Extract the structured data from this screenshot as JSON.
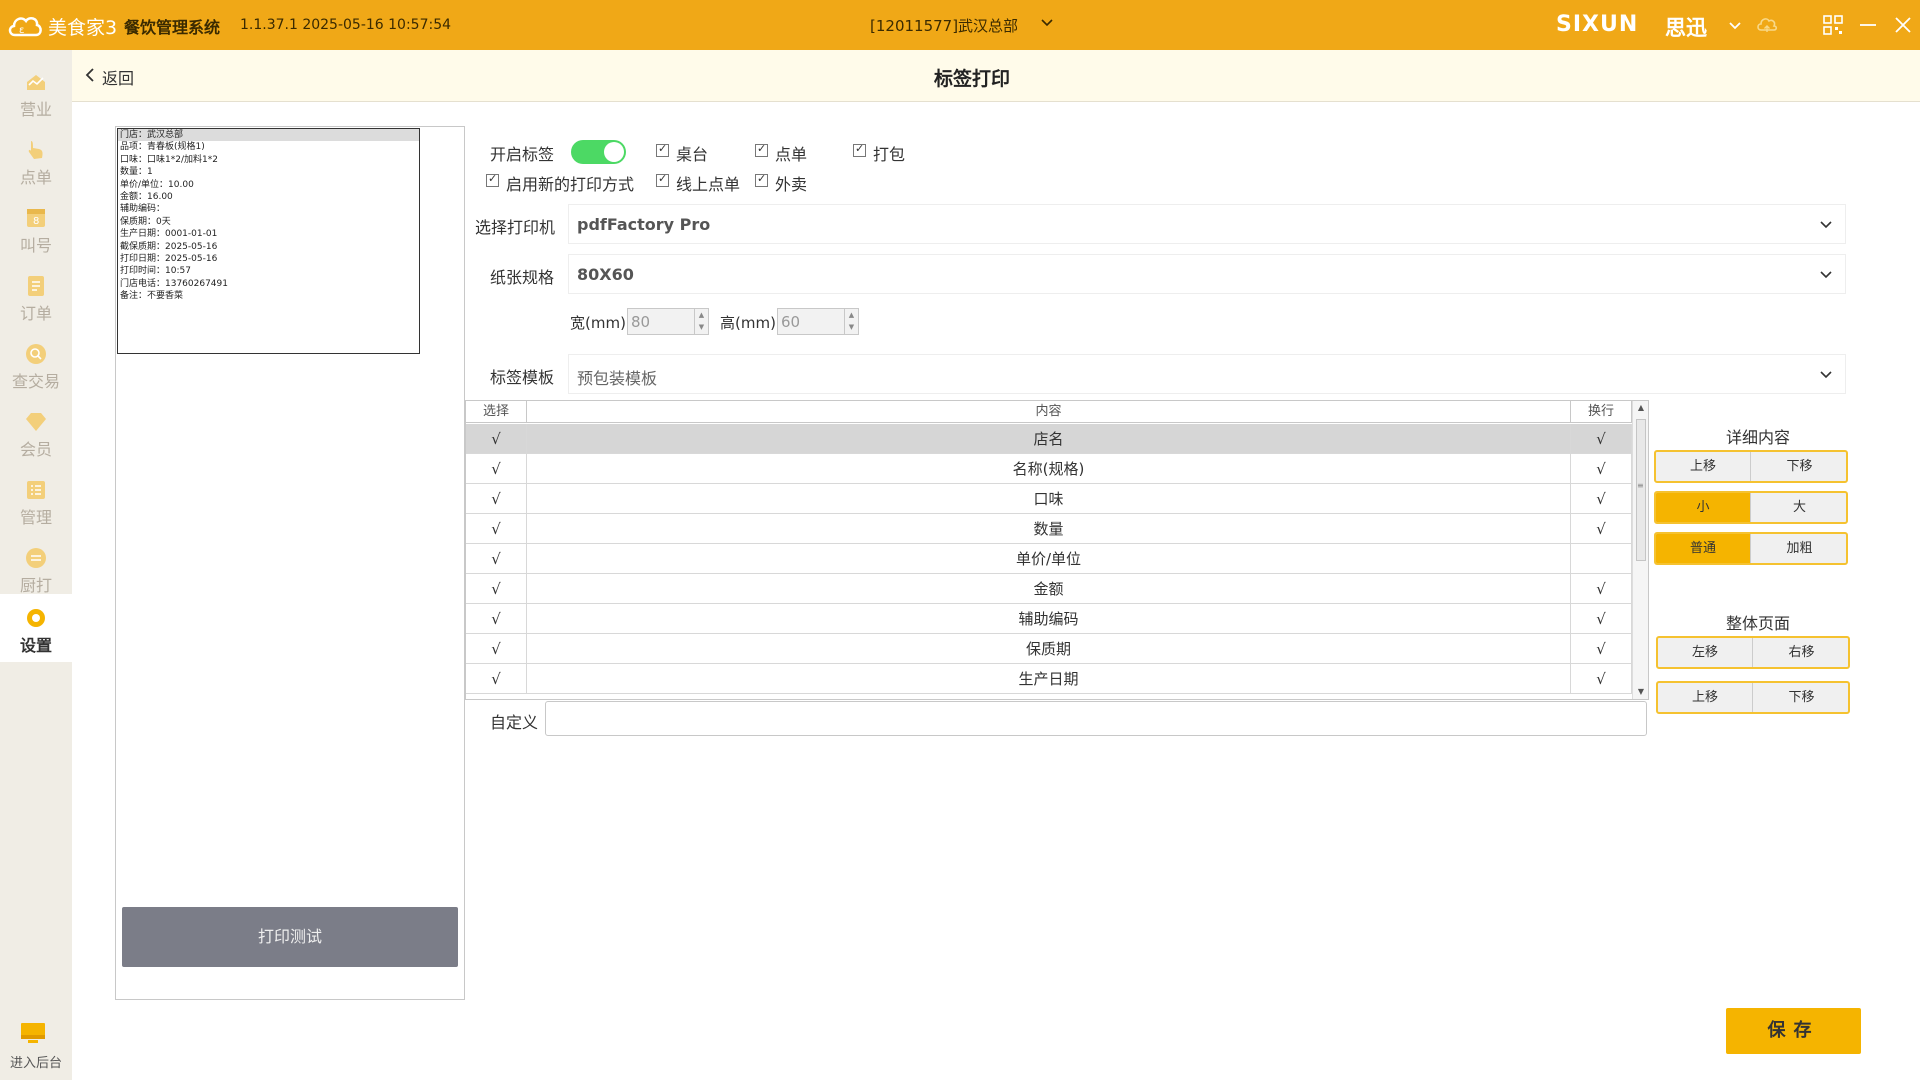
{
  "titlebar": {
    "brand": "美食家3",
    "system_name": "餐饮管理系统",
    "version": "1.1.37.1 2025-05-16 10:57:54",
    "store": "[12011577]武汉总部",
    "vendor_logo": "SIXUN",
    "vendor_logo_cn": "思迅",
    "icons": [
      "cloud-logo-icon",
      "chevron-down-icon",
      "cloud-sync-icon",
      "qr-code-icon",
      "minimize-icon",
      "close-icon"
    ]
  },
  "sidebar": {
    "items": [
      {
        "label": "营业",
        "icon": "business-icon"
      },
      {
        "label": "点单",
        "icon": "order-hand-icon"
      },
      {
        "label": "叫号",
        "icon": "call-number-icon"
      },
      {
        "label": "订单",
        "icon": "order-list-icon"
      },
      {
        "label": "查交易",
        "icon": "search-trade-icon"
      },
      {
        "label": "会员",
        "icon": "member-diamond-icon"
      },
      {
        "label": "管理",
        "icon": "manage-icon"
      },
      {
        "label": "厨打",
        "icon": "kitchen-print-icon"
      },
      {
        "label": "设置",
        "icon": "gear-icon",
        "active": true
      }
    ],
    "backend_label": "进入后台"
  },
  "header": {
    "back_label": "返回",
    "title": "标签打印"
  },
  "preview": {
    "lines": [
      "门店：武汉总部",
      "品项：青春板(规格1)",
      "口味：口味1*2/加料1*2",
      "数量：1",
      "单价/单位：10.00",
      "金额：16.00",
      "辅助编码：",
      "保质期：0天",
      "生产日期：0001-01-01",
      "截保质期：2025-05-16",
      "打印日期：2025-05-16",
      "打印时间：10:57",
      "门店电话：13760267491",
      "备注：不要香菜"
    ],
    "print_test_label": "打印测试"
  },
  "form": {
    "enable_label": "开启标签",
    "enable_on": true,
    "checkboxes_row1": [
      {
        "label": "桌台",
        "checked": true
      },
      {
        "label": "点单",
        "checked": true
      },
      {
        "label": "打包",
        "checked": true
      }
    ],
    "new_print_label": "启用新的打印方式",
    "checkboxes_row2": [
      {
        "label": "线上点单",
        "checked": true
      },
      {
        "label": "外卖",
        "checked": true
      }
    ],
    "printer_label": "选择打印机",
    "printer_value": "pdfFactory Pro",
    "paper_label": "纸张规格",
    "paper_value": "80X60",
    "width_label": "宽(mm)",
    "width_value": "80",
    "height_label": "高(mm)",
    "height_value": "60",
    "template_label": "标签模板",
    "template_value": "预包装模板",
    "custom_label": "自定义",
    "custom_value": ""
  },
  "table": {
    "headers": [
      "选择",
      "内容",
      "换行"
    ],
    "rows": [
      {
        "select": "√",
        "content": "店名",
        "wrap": "√"
      },
      {
        "select": "√",
        "content": "名称(规格)",
        "wrap": "√"
      },
      {
        "select": "√",
        "content": "口味",
        "wrap": "√"
      },
      {
        "select": "√",
        "content": "数量",
        "wrap": "√"
      },
      {
        "select": "√",
        "content": "单价/单位",
        "wrap": ""
      },
      {
        "select": "√",
        "content": "金额",
        "wrap": "√"
      },
      {
        "select": "√",
        "content": "辅助编码",
        "wrap": "√"
      },
      {
        "select": "√",
        "content": "保质期",
        "wrap": "√"
      },
      {
        "select": "√",
        "content": "生产日期",
        "wrap": "√"
      }
    ],
    "selected_row": 0
  },
  "controls": {
    "detail_title": "详细内容",
    "detail_move": [
      "上移",
      "下移"
    ],
    "size": [
      "小",
      "大"
    ],
    "weight": [
      "普通",
      "加粗"
    ],
    "page_title": "整体页面",
    "page_lr": [
      "左移",
      "右移"
    ],
    "page_ud": [
      "上移",
      "下移"
    ]
  },
  "save_label": "保存",
  "colors": {
    "brand": "#f0a817",
    "accent": "#f5b400",
    "toggle_on": "#4cd964",
    "print_test_bg": "#7b7d88"
  }
}
